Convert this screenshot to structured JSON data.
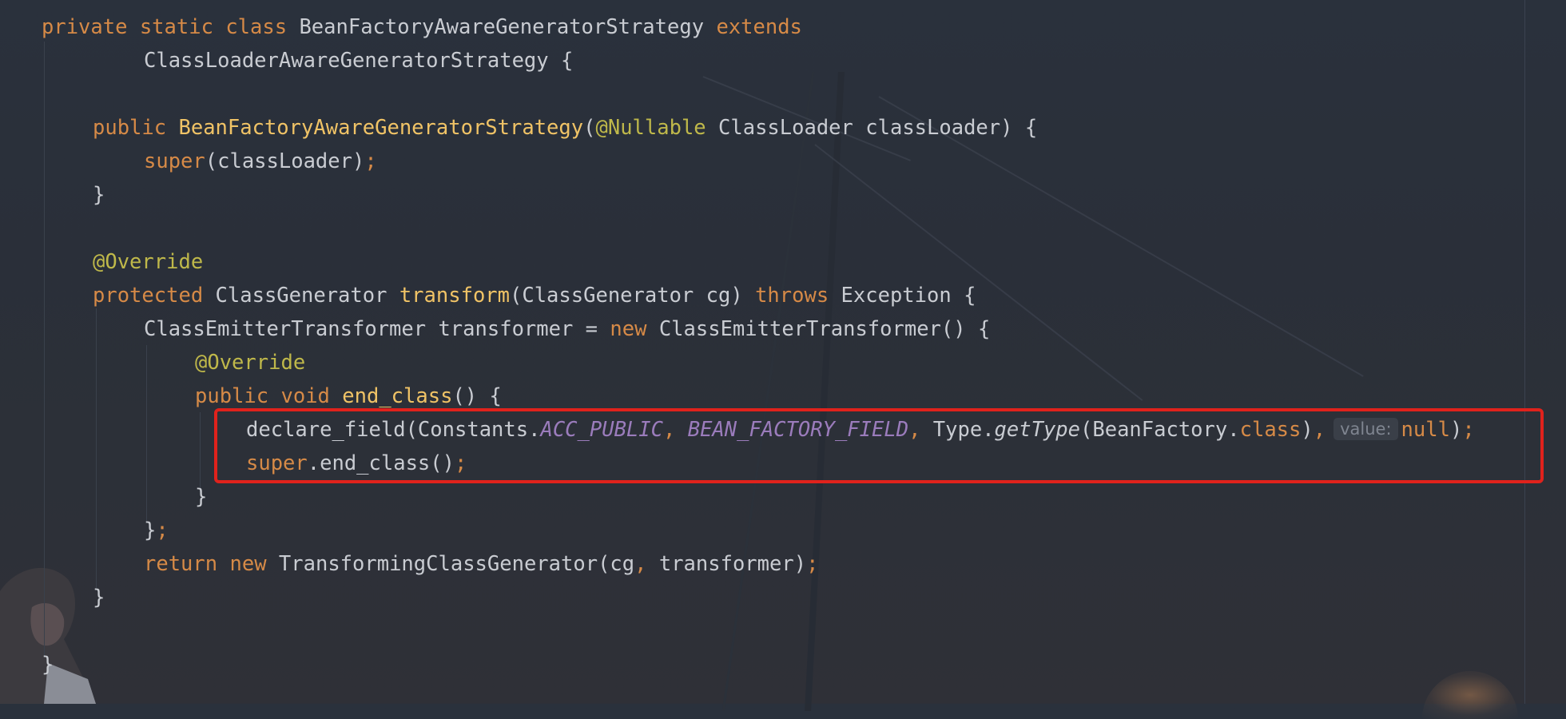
{
  "editor": {
    "highlight_color": "#e0221c",
    "lines": {
      "l1": {
        "kw_private": "private",
        "kw_static": "static",
        "kw_class": "class",
        "class_name": "BeanFactoryAwareGeneratorStrategy",
        "kw_extends": "extends"
      },
      "l2": {
        "superclass": "ClassLoaderAwareGeneratorStrategy",
        "brace": "{"
      },
      "l3": {
        "kw_public": "public",
        "ctor_name": "BeanFactoryAwareGeneratorStrategy",
        "paren_open": "(",
        "annotation": "@Nullable",
        "param_type": "ClassLoader",
        "param_name": "classLoader",
        "tail": ") {"
      },
      "l4": {
        "kw_super": "super",
        "args": "(classLoader)",
        "semi": ";"
      },
      "l5": {
        "brace": "}"
      },
      "l6": {
        "annotation": "@Override"
      },
      "l7": {
        "kw_protected": "protected",
        "return_type": "ClassGenerator",
        "method": "transform",
        "params": "(ClassGenerator cg)",
        "kw_throws": "throws",
        "exception": "Exception",
        "brace": "{"
      },
      "l8": {
        "decl": "ClassEmitterTransformer transformer = ",
        "kw_new": "new",
        "ctor": "ClassEmitterTransformer() {"
      },
      "l9": {
        "annotation": "@Override"
      },
      "l10": {
        "kw_public": "public",
        "kw_void": "void",
        "method": "end_class",
        "tail": "() {"
      },
      "l11": {
        "call": "declare_field(Constants.",
        "const1": "ACC_PUBLIC",
        "comma1": ",",
        "const2": "BEAN_FACTORY_FIELD",
        "comma2": ",",
        "type_prefix": "Type.",
        "static_method": "getType",
        "arg_open": "(BeanFactory.",
        "kw_class": "class",
        "arg_close": ")",
        "comma3": ",",
        "hint": "value:",
        "kw_null": "null",
        "close": ")",
        "semi": ";"
      },
      "l12": {
        "kw_super": "super",
        "call": ".end_class()",
        "semi": ";"
      },
      "l13": {
        "brace": "}"
      },
      "l14": {
        "brace": "}",
        "semi": ";"
      },
      "l15": {
        "kw_return": "return",
        "kw_new": "new",
        "ctor": "TransformingClassGenerator(cg",
        "comma": ",",
        "args": "transformer)",
        "semi": ";"
      },
      "l16": {
        "brace": "}"
      },
      "l17": {
        "brace": "}"
      }
    }
  }
}
